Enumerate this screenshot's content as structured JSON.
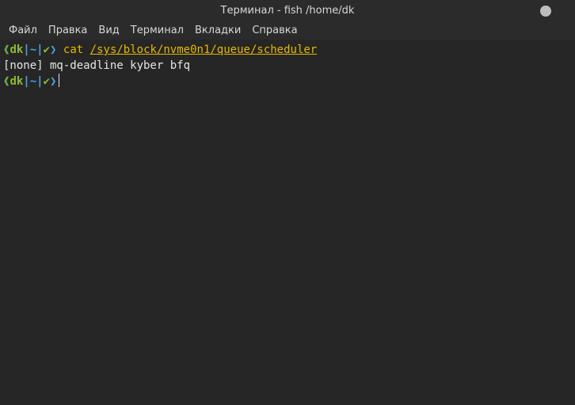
{
  "window": {
    "title": "Терминал - fish /home/dk"
  },
  "menu": {
    "items": [
      "Файл",
      "Правка",
      "Вид",
      "Терминал",
      "Вкладки",
      "Справка"
    ]
  },
  "terminal": {
    "prompt": {
      "open": "❰",
      "user": "dk",
      "sep": "|",
      "dir": "~",
      "check": "✔",
      "arrow": "❯"
    },
    "line1": {
      "command": "cat",
      "argument": "/sys/block/nvme0n1/queue/scheduler"
    },
    "output": "[none] mq-deadline kyber bfq"
  }
}
